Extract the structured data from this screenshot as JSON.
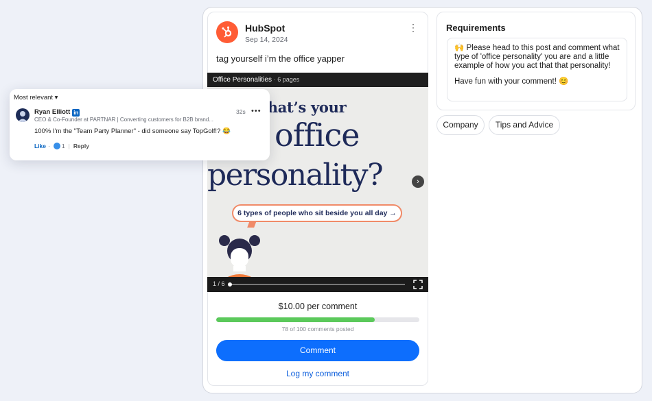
{
  "post": {
    "author": "HubSpot",
    "date": "Sep 14, 2024",
    "more_label": "⋮",
    "text": "tag yourself i’m the office yapper",
    "brand_color": "#ff5c35"
  },
  "carousel": {
    "doc_title": "Office Personalities",
    "pages_label": "6 pages",
    "line1": "what’s your",
    "line2": "office",
    "line3": "personality?",
    "bubble_text": "6 types of people who sit beside you all day →",
    "counter": "1 / 6",
    "next_icon": "chevron-right-icon",
    "fullscreen_icon": "fullscreen-icon"
  },
  "bounty": {
    "price": "$10.00 per comment",
    "progress_posted": 78,
    "progress_total": 100,
    "progress_label": "78 of 100 comments posted",
    "progress_color": "#5bc95b",
    "comment_button": "Comment",
    "comment_button_color": "#0d6efd",
    "log_link": "Log my comment"
  },
  "requirements": {
    "title": "Requirements",
    "line1": "🙌 Please head to this post and comment what type of 'office personality' you are and a little example of how you act that that personality!",
    "line2": "Have fun with your comment! 😊"
  },
  "tags": [
    "Company",
    "Tips and Advice"
  ],
  "comment_popup": {
    "sort_label": "Most relevant ▾",
    "name": "Ryan Elliott",
    "badge": "in",
    "headline": "CEO & Co-Founder at PARTNAR | Converting customers for B2B brand...",
    "time": "32s",
    "more": "•••",
    "text": "100% I'm the \"Team Party Planner\" - did someone say TopGolf!? 😂",
    "like_label": "Like",
    "dot": "·",
    "reaction_count": "1",
    "separator": "|",
    "reply_label": "Reply"
  }
}
